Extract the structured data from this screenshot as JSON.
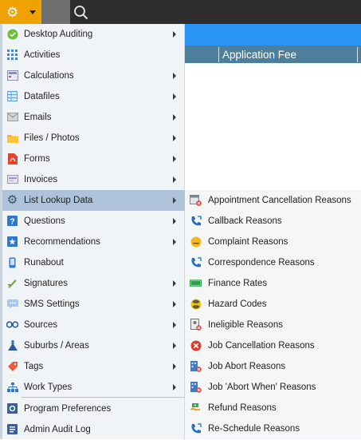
{
  "toolbar": {
    "gear_icon": "gear-icon",
    "caret_icon": "caret-down-icon",
    "search_icon": "search-icon"
  },
  "grid": {
    "column_header": "Application Fee"
  },
  "menu": {
    "items": [
      {
        "label": "Desktop Auditing",
        "icon": "check-circle-icon",
        "submenu": true
      },
      {
        "label": "Activities",
        "icon": "grid-dots-icon",
        "submenu": false
      },
      {
        "label": "Calculations",
        "icon": "calculator-icon",
        "submenu": true
      },
      {
        "label": "Datafiles",
        "icon": "table-icon",
        "submenu": true
      },
      {
        "label": "Emails",
        "icon": "envelope-icon",
        "submenu": true
      },
      {
        "label": "Files / Photos",
        "icon": "folder-icon",
        "submenu": true
      },
      {
        "label": "Forms",
        "icon": "pdf-icon",
        "submenu": true
      },
      {
        "label": "Invoices",
        "icon": "invoice-icon",
        "submenu": true
      },
      {
        "label": "List Lookup Data",
        "icon": "gear-icon",
        "submenu": true,
        "active": true
      },
      {
        "label": "Questions",
        "icon": "question-icon",
        "submenu": true
      },
      {
        "label": "Recommendations",
        "icon": "star-icon",
        "submenu": true
      },
      {
        "label": "Runabout",
        "icon": "phone-icon",
        "submenu": false
      },
      {
        "label": "Signatures",
        "icon": "signature-icon",
        "submenu": true
      },
      {
        "label": "SMS Settings",
        "icon": "chat-icon",
        "submenu": true
      },
      {
        "label": "Sources",
        "icon": "binoculars-icon",
        "submenu": true
      },
      {
        "label": "Suburbs / Areas",
        "icon": "flask-icon",
        "submenu": true
      },
      {
        "label": "Tags",
        "icon": "tag-icon",
        "submenu": true
      },
      {
        "label": "Work Types",
        "icon": "hierarchy-icon",
        "submenu": true
      },
      {
        "label": "Program Preferences",
        "icon": "settings-icon",
        "submenu": false
      },
      {
        "label": "Admin Audit Log",
        "icon": "log-icon",
        "submenu": false
      }
    ]
  },
  "submenu": {
    "items": [
      {
        "label": "Appointment Cancellation Reasons",
        "icon": "calendar-cancel-icon"
      },
      {
        "label": "Callback Reasons",
        "icon": "phone-callback-icon"
      },
      {
        "label": "Complaint Reasons",
        "icon": "sad-face-icon"
      },
      {
        "label": "Correspondence Reasons",
        "icon": "phone-callback-icon"
      },
      {
        "label": "Finance Rates",
        "icon": "money-icon"
      },
      {
        "label": "Hazard Codes",
        "icon": "radiation-icon"
      },
      {
        "label": "Ineligible Reasons",
        "icon": "ineligible-icon"
      },
      {
        "label": "Job Cancellation Reasons",
        "icon": "cancel-circle-icon"
      },
      {
        "label": "Job Abort Reasons",
        "icon": "building-cancel-icon"
      },
      {
        "label": "Job 'Abort When' Reasons",
        "icon": "building-cancel-icon"
      },
      {
        "label": "Refund Reasons",
        "icon": "refund-icon"
      },
      {
        "label": "Re-Schedule Reasons",
        "icon": "phone-callback-icon"
      }
    ]
  },
  "colors": {
    "toolbar": "#2d2d2d",
    "gear_button": "#f0a300",
    "accent_band": "#2894f4",
    "grid_header": "#4d7f9d",
    "menu_bg": "#f1f4f7",
    "menu_active": "#aec3da"
  }
}
